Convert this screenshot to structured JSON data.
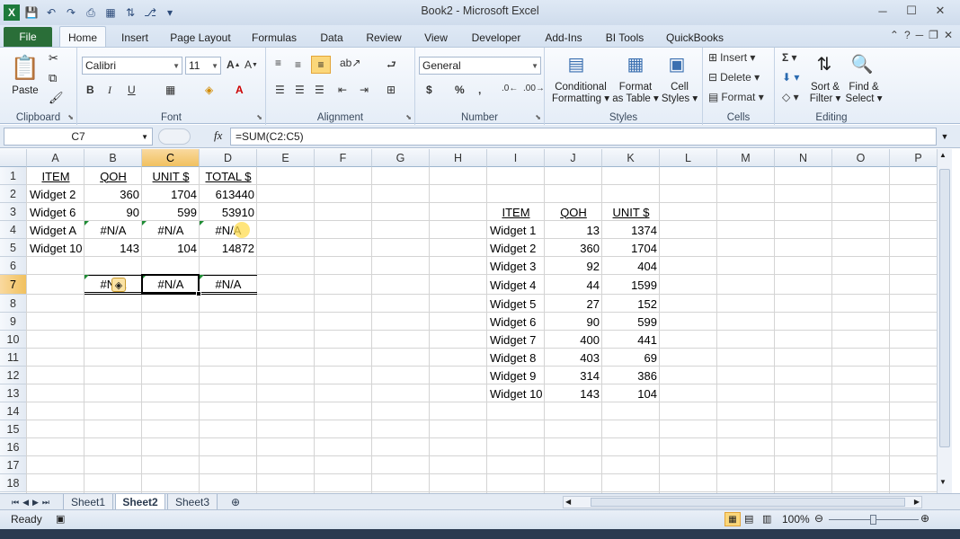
{
  "window": {
    "title": "Book2 - Microsoft Excel",
    "min": "─",
    "max": "☐",
    "close": "✕"
  },
  "qat": {
    "logo": "X",
    "save": "💾",
    "undo": "↶",
    "redo": "↷",
    "more": "▾"
  },
  "tabs": [
    "File",
    "Home",
    "Insert",
    "Page Layout",
    "Formulas",
    "Data",
    "Review",
    "View",
    "Developer",
    "Add-Ins",
    "BI Tools",
    "QuickBooks"
  ],
  "ribbon": {
    "clipboard": {
      "label": "Clipboard",
      "paste": "Paste"
    },
    "font": {
      "label": "Font",
      "name": "Calibri",
      "size": "11",
      "bold": "B",
      "italic": "I",
      "underline": "U"
    },
    "alignment": {
      "label": "Alignment"
    },
    "number": {
      "label": "Number",
      "format": "General",
      "currency": "$",
      "percent": "%",
      "comma": ","
    },
    "styles": {
      "label": "Styles",
      "cond1": "Conditional",
      "cond2": "Formatting",
      "fmt1": "Format",
      "fmt2": "as Table",
      "cell1": "Cell",
      "cell2": "Styles"
    },
    "cells": {
      "label": "Cells",
      "insert": "Insert",
      "delete": "Delete",
      "format": "Format"
    },
    "editing": {
      "label": "Editing",
      "sort1": "Sort &",
      "sort2": "Filter",
      "find1": "Find &",
      "find2": "Select"
    }
  },
  "formula_bar": {
    "name_box": "C7",
    "fx": "fx",
    "formula": "=SUM(C2:C5)"
  },
  "columns": [
    "A",
    "B",
    "C",
    "D",
    "E",
    "F",
    "G",
    "H",
    "I",
    "J",
    "K",
    "L",
    "M",
    "N",
    "O",
    "P"
  ],
  "rows": [
    "1",
    "2",
    "3",
    "4",
    "5",
    "6",
    "7",
    "8",
    "9",
    "10",
    "11",
    "12",
    "13",
    "14",
    "15",
    "16",
    "17",
    "18"
  ],
  "table1": {
    "headers": [
      "ITEM",
      "QOH",
      "UNIT $",
      "TOTAL $"
    ],
    "rows": [
      [
        "Widget 2",
        "360",
        "1704",
        "613440"
      ],
      [
        "Widget 6",
        "90",
        "599",
        "53910"
      ],
      [
        "Widget A",
        "#N/A",
        "#N/A",
        "#N/A"
      ],
      [
        "Widget 10",
        "143",
        "104",
        "14872"
      ]
    ],
    "totals": [
      "#N/A",
      "#N/A",
      "#N/A"
    ]
  },
  "table2": {
    "headers": [
      "ITEM",
      "QOH",
      "UNIT $"
    ],
    "rows": [
      [
        "Widget 1",
        "13",
        "1374"
      ],
      [
        "Widget 2",
        "360",
        "1704"
      ],
      [
        "Widget 3",
        "92",
        "404"
      ],
      [
        "Widget 4",
        "44",
        "1599"
      ],
      [
        "Widget 5",
        "27",
        "152"
      ],
      [
        "Widget 6",
        "90",
        "599"
      ],
      [
        "Widget 7",
        "400",
        "441"
      ],
      [
        "Widget 8",
        "403",
        "69"
      ],
      [
        "Widget 9",
        "314",
        "386"
      ],
      [
        "Widget 10",
        "143",
        "104"
      ]
    ]
  },
  "sheets": [
    "Sheet1",
    "Sheet2",
    "Sheet3"
  ],
  "status": {
    "ready": "Ready",
    "zoom": "100%"
  }
}
